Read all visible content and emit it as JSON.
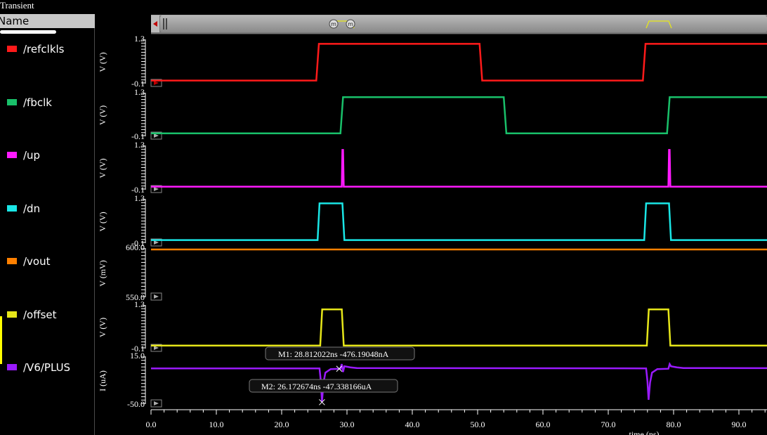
{
  "window": {
    "title": "Transient"
  },
  "legend": {
    "header": "Name",
    "items": [
      {
        "label": "/refclkls",
        "color": "#ff1a1a"
      },
      {
        "label": "/fbclk",
        "color": "#19c06a"
      },
      {
        "label": "/up",
        "color": "#ff1aff"
      },
      {
        "label": "/dn",
        "color": "#1ae6e6"
      },
      {
        "label": "/vout",
        "color": "#ff8000"
      },
      {
        "label": "/offset",
        "color": "#e6e619"
      },
      {
        "label": "/V6/PLUS",
        "color": "#9a1aff"
      }
    ]
  },
  "scrollbar": {
    "marker_1": "m",
    "marker_2": "m"
  },
  "chart_data": {
    "type": "line",
    "xlabel": "time (ns)",
    "xlim": [
      0,
      94.3
    ],
    "x_ticks": [
      "0.0",
      "10.0",
      "20.0",
      "30.0",
      "40.0",
      "50.0",
      "60.0",
      "70.0",
      "80.0",
      "90.0"
    ],
    "subplots": [
      {
        "name": "/refclkls",
        "ylabel": "V (V)",
        "ymax_label": "1.3",
        "ymin_label": "-0.1",
        "ylim": [
          -0.1,
          1.3
        ],
        "x": [
          0,
          25.3,
          25.7,
          50.3,
          50.7,
          75.3,
          75.7,
          94.3
        ],
        "y": [
          0,
          0,
          1.2,
          1.2,
          0,
          0,
          1.2,
          1.2
        ]
      },
      {
        "name": "/fbclk",
        "ylabel": "V (V)",
        "ymax_label": "1.3",
        "ymin_label": "-0.1",
        "ylim": [
          -0.1,
          1.3
        ],
        "x": [
          0,
          29.0,
          29.4,
          54.0,
          54.4,
          79.0,
          79.4,
          94.3
        ],
        "y": [
          0,
          0,
          1.2,
          1.2,
          0,
          0,
          1.2,
          1.2
        ]
      },
      {
        "name": "/up",
        "ylabel": "V (V)",
        "ymax_label": "1.3",
        "ymin_label": "-0.1",
        "ylim": [
          -0.1,
          1.3
        ],
        "x": [
          0,
          29.2,
          29.3,
          29.4,
          29.5,
          79.2,
          79.3,
          79.4,
          79.5,
          94.3
        ],
        "y": [
          0,
          0,
          1.2,
          1.2,
          0,
          0,
          1.2,
          1.2,
          0,
          0
        ]
      },
      {
        "name": "/dn",
        "ylabel": "V (V)",
        "ymax_label": "1.3",
        "ymin_label": "-0.1",
        "ylim": [
          -0.1,
          1.3
        ],
        "x": [
          0,
          25.5,
          25.8,
          29.3,
          29.6,
          75.5,
          75.8,
          79.3,
          79.6,
          94.3
        ],
        "y": [
          0,
          0,
          1.2,
          1.2,
          0,
          0,
          1.2,
          1.2,
          0,
          0
        ]
      },
      {
        "name": "/vout",
        "ylabel": "V (mV)",
        "ymax_label": "600.0",
        "ymin_label": "550.0",
        "ylim": [
          550,
          600
        ],
        "x": [
          0,
          94.3
        ],
        "y": [
          600,
          600
        ]
      },
      {
        "name": "/offset",
        "ylabel": "V (V)",
        "ymax_label": "1.3",
        "ymin_label": "-0.1",
        "ylim": [
          -0.1,
          1.3
        ],
        "x": [
          0,
          25.9,
          26.2,
          29.2,
          29.5,
          75.9,
          76.2,
          79.2,
          79.5,
          94.3
        ],
        "y": [
          0,
          0,
          1.2,
          1.2,
          0,
          0,
          1.2,
          1.2,
          0,
          0
        ]
      },
      {
        "name": "/V6/PLUS",
        "ylabel": "I (uA)",
        "ymax_label": "15.0",
        "ymin_label": "-50.0",
        "ylim": [
          -50,
          15
        ],
        "x": [
          0,
          25.8,
          26.0,
          26.17,
          26.4,
          26.7,
          27.5,
          29.0,
          29.2,
          29.4,
          29.6,
          30.5,
          31.5,
          75.8,
          76.0,
          76.17,
          76.4,
          76.7,
          77.5,
          79.2,
          79.4,
          79.6,
          80.5,
          81.5,
          94.3
        ],
        "y": [
          0,
          0,
          -18,
          -47.3,
          -20,
          -6,
          -1,
          -0.5,
          6,
          -5,
          3,
          1.5,
          0.5,
          0,
          -18,
          -44,
          -20,
          -6,
          -1,
          -0.5,
          6,
          3,
          1.5,
          0.5,
          0.3
        ]
      }
    ],
    "markers": [
      {
        "text": "M1: 28.812022ns -476.19048nA",
        "x": 28.81,
        "subplot": 6,
        "y": -0.476
      },
      {
        "text": "M2: 26.172674ns -47.338166uA",
        "x": 26.17,
        "subplot": 6,
        "y": -47.34
      }
    ]
  }
}
